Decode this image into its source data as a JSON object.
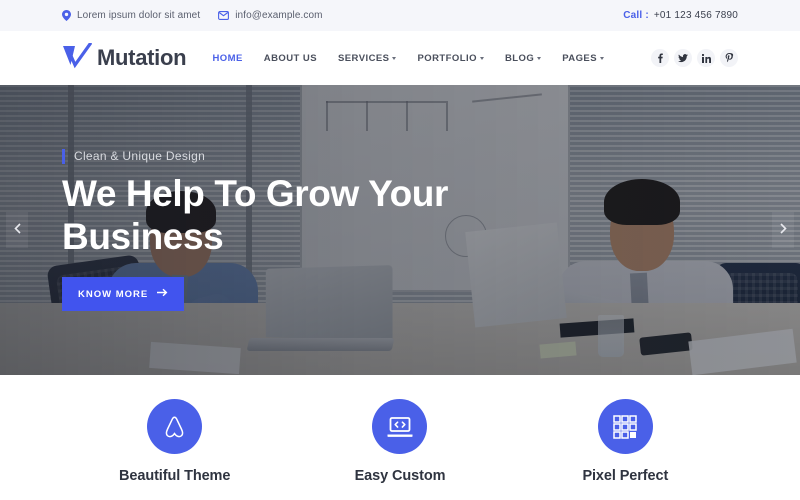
{
  "topbar": {
    "location_icon": "map-pin-icon",
    "location": "Lorem ipsum dolor sit amet",
    "email_icon": "envelope-icon",
    "email": "info@example.com",
    "call_label": "Call :",
    "phone": "+01 123 456 7890"
  },
  "header": {
    "logo_icon": "checkmark-logo-icon",
    "logo_text": "Mutation",
    "nav": [
      {
        "label": "HOME",
        "active": true,
        "has_caret": false
      },
      {
        "label": "ABOUT US",
        "active": false,
        "has_caret": false
      },
      {
        "label": "SERVICES",
        "active": false,
        "has_caret": true
      },
      {
        "label": "PORTFOLIO",
        "active": false,
        "has_caret": true
      },
      {
        "label": "BLOG",
        "active": false,
        "has_caret": true
      },
      {
        "label": "PAGES",
        "active": false,
        "has_caret": true
      }
    ],
    "socials": [
      {
        "name": "facebook-icon",
        "glyph": "f"
      },
      {
        "name": "twitter-icon",
        "glyph": "t"
      },
      {
        "name": "linkedin-icon",
        "glyph": "in"
      },
      {
        "name": "pinterest-icon",
        "glyph": "p"
      }
    ]
  },
  "hero": {
    "subtitle": "Clean & Unique Design",
    "title": "We Help To Grow Your Business",
    "cta_label": "KNOW MORE",
    "cta_arrow": "arrow-right-icon",
    "prev_icon": "chevron-left-icon",
    "next_icon": "chevron-right-icon"
  },
  "features": [
    {
      "icon": "arch-badge-icon",
      "label": "Beautiful Theme"
    },
    {
      "icon": "laptop-code-icon",
      "label": "Easy Custom"
    },
    {
      "icon": "pixel-grid-icon",
      "label": "Pixel Perfect"
    }
  ],
  "colors": {
    "accent": "#4a60e8",
    "cta": "#4154ee",
    "topbar_bg": "#f5f6fa",
    "text_dark": "#3a3f4d",
    "nav_text": "#4a4f5c"
  }
}
